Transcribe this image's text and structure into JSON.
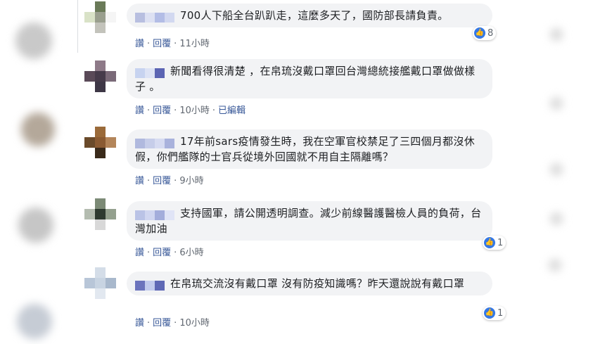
{
  "comments": [
    {
      "text": "700人下船全台趴趴走，這麼多天了，國防部長請負責。",
      "actions": {
        "read": "讚",
        "reply": "回覆",
        "time": "11小時",
        "edited": ""
      },
      "likes": "8"
    },
    {
      "text": "新聞看得很清楚 ，在帛琉沒戴口罩回台灣總統接艦戴口罩做做樣子 。",
      "actions": {
        "read": "讚",
        "reply": "回覆",
        "time": "10小時",
        "edited": "已編輯"
      },
      "likes": ""
    },
    {
      "text": "17年前sars疫情發生時，我在空軍官校禁足了三四個月都沒休假，你們艦隊的士官兵從境外回國就不用自主隔離嗎？",
      "actions": {
        "read": "讚",
        "reply": "回覆",
        "time": "9小時",
        "edited": ""
      },
      "likes": ""
    },
    {
      "text": "支持國軍，請公開透明調查。減少前線醫護醫檢人員的負荷，台灣加油",
      "actions": {
        "read": "讚",
        "reply": "回覆",
        "time": "6小時",
        "edited": ""
      },
      "likes": "1"
    },
    {
      "text": "在帛琉交流沒有戴口罩 沒有防疫知識嗎？昨天還說說有戴口罩",
      "actions": {
        "read": "讚",
        "reply": "回覆",
        "time": "10小時",
        "edited": ""
      },
      "likes": "1"
    }
  ],
  "colors": {
    "link": "#385898",
    "bubble": "#f2f3f5",
    "like": "#3578e5"
  },
  "icons": {
    "like": "thumbs-up-icon"
  }
}
